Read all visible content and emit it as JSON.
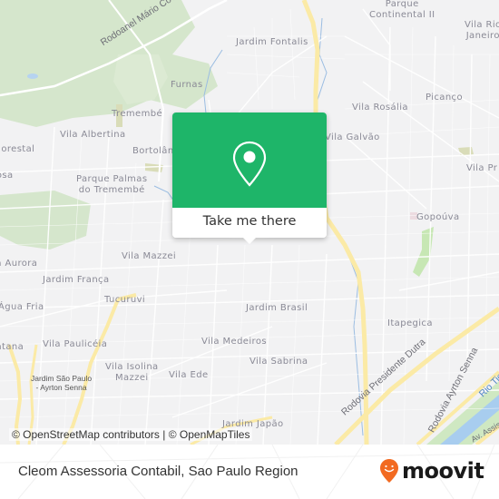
{
  "map": {
    "labels": {
      "rodoanel": "Rodoanel Mário Covas",
      "jardim_fontalis": "Jardim Fontalis",
      "parque_continental_1": "Parque",
      "parque_continental_2": "Continental II",
      "vila_rio_1": "Vila Rio",
      "vila_rio_2": "Janeiro",
      "furnas": "Furnas",
      "vila_rosalia": "Vila Rosália",
      "picanco": "Picanço",
      "tremembe": "Tremembé",
      "vila_albertina": "Vila Albertina",
      "bortolandia": "Bortolândia",
      "vila_galvao": "Vila Galvão",
      "florestal": "Florestal",
      "rosa": "Rosa",
      "vila_pr": "Vila Pr",
      "parque_palmas_1": "Parque Palmas",
      "parque_palmas_2": "do Tremembé",
      "gopouva": "Gopoúva",
      "vila_mazzei": "Vila Mazzei",
      "vila_aurora": "Vila Aurora",
      "jardim_franca": "Jardim França",
      "tucuruvi": "Tucuruvi",
      "jardim_brasil": "Jardim Brasil",
      "agua_fria": "Água Fria",
      "itapegica": "Itapegica",
      "santana": "Santana",
      "vila_paulliceia": "Vila Paulicéia",
      "vila_medeiros": "Vila Medeiros",
      "vila_sabrina": "Vila Sabrina",
      "jardim_sao_paulo_1": "Jardim São Paulo",
      "jardim_sao_paulo_2": "- Ayrton Senna",
      "vila_isolina_1": "Vila Isolina",
      "vila_isolina_2": "Mazzei",
      "vila_ede": "Vila Ede",
      "jardim_japao": "Jardim Japão",
      "rodovia_dutra": "Rodovia Presidente Dutra",
      "rodovia_senna": "Rodovia Ayrton Senna",
      "rio_tiete": "Rio Tietê",
      "marginal": "Av. Assis"
    },
    "attribution": "© OpenStreetMap contributors | © OpenMapTiles"
  },
  "popup": {
    "icon": "map-pin-icon",
    "cta_label": "Take me there",
    "color": "#1eb569"
  },
  "footer": {
    "place_name": "Cleom Assessoria Contabil, Sao Paulo Region",
    "logo_text": "moovit",
    "logo_color": "#f26a21"
  }
}
